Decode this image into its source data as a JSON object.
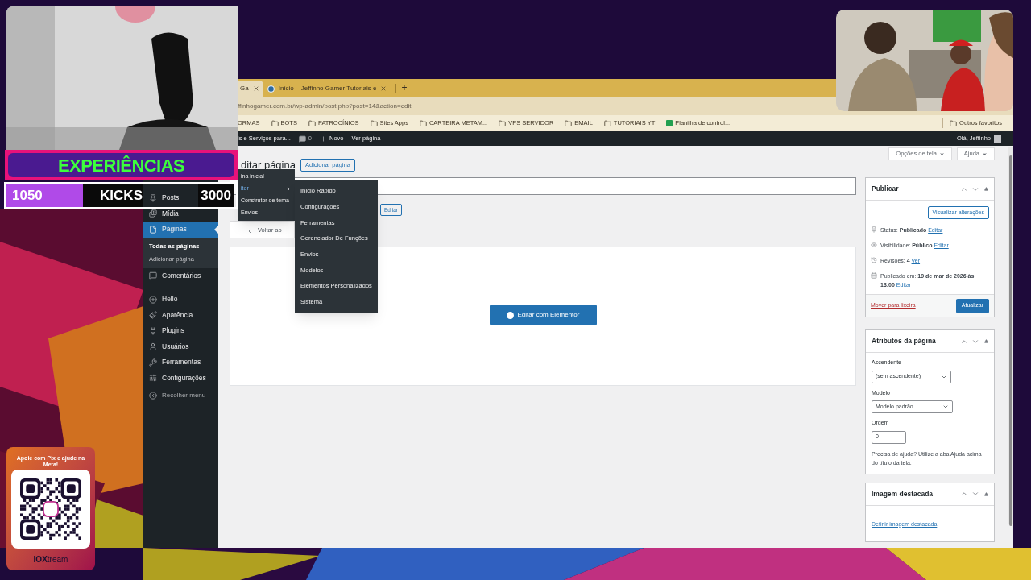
{
  "overlay": {
    "banner": "EXPERIÊNCIAS",
    "counter": {
      "current": "1050",
      "label": "KICKS",
      "goal": "3000"
    },
    "pix_card": {
      "title": "Apoie com Pix e ajude na Meta!",
      "brand": "**IOX**tream"
    }
  },
  "browser": {
    "tabs": [
      {
        "label": "Ga",
        "selected": true
      },
      {
        "label": "Início – Jeffinho Gamer Tutoriais e",
        "selected": false
      }
    ],
    "new_tab": "+",
    "address": "ffinhogamer.com.br/wp-admin/post.php?post=14&action=edit",
    "bookmarks": [
      {
        "label": "ORMAS",
        "kind": "text"
      },
      {
        "label": "BOTS",
        "kind": "folder"
      },
      {
        "label": "PATROCÍNIOS",
        "kind": "folder"
      },
      {
        "label": "Sites Apps",
        "kind": "folder"
      },
      {
        "label": "CARTEIRA METAM...",
        "kind": "folder"
      },
      {
        "label": "VPS SERVIDOR",
        "kind": "folder"
      },
      {
        "label": "EMAIL",
        "kind": "folder"
      },
      {
        "label": "TUTORIAIS YT",
        "kind": "folder"
      },
      {
        "label": "Planilha de control...",
        "kind": "sheet"
      }
    ],
    "other_bookmarks": "Outros favoritos"
  },
  "admin_bar": {
    "site": "is e Serviços para...",
    "comments": "0",
    "new": "Novo",
    "view": "Ver página",
    "greeting": "Olá, Jeffinho"
  },
  "sidebar": {
    "groups": [
      [
        {
          "label": "Posts",
          "selected": false
        },
        {
          "label": "Mídia",
          "selected": false
        },
        {
          "label": "Páginas",
          "selected": true,
          "children": [
            {
              "label": "Todas as páginas",
              "selected": true
            },
            {
              "label": "Adicionar página",
              "selected": false
            }
          ]
        },
        {
          "label": "Comentários",
          "selected": false
        }
      ],
      [
        {
          "label": "Hello",
          "selected": false
        },
        {
          "label": "Aparência",
          "selected": false
        },
        {
          "label": "Plugins",
          "selected": false
        },
        {
          "label": "Usuários",
          "selected": false
        },
        {
          "label": "Ferramentas",
          "selected": false
        },
        {
          "label": "Configurações",
          "selected": false
        }
      ]
    ],
    "collapse": "Recolher menu"
  },
  "flyout": {
    "items": [
      {
        "label": "ina inicial",
        "expanded": false
      },
      {
        "label": "itor",
        "expanded": true
      },
      {
        "label": "Construtor de tema",
        "expanded": false
      },
      {
        "label": "Envios",
        "expanded": false
      }
    ],
    "submenu": [
      "Início Rápido",
      "Configurações",
      "Ferramentas",
      "Gerenciador De Funções",
      "Envios",
      "Modelos",
      "Elementos Personalizados",
      "Sistema"
    ]
  },
  "screen_options": "Opções de tela",
  "help": "Ajuda",
  "editor": {
    "title": "ditar página",
    "add_new": "Adicionar página",
    "edit_button": "Editar",
    "back": "Voltar ao",
    "elementor_button": "Editar com Elementor"
  },
  "publish_box": {
    "title": "Publicar",
    "preview": "Visualizar alterações",
    "rows": [
      {
        "text": "Status: **Publicado**",
        "link": "Editar"
      },
      {
        "text": "Visibilidade: **Público**",
        "link": "Editar"
      },
      {
        "text": "Revisões: **4**",
        "link": "Ver"
      },
      {
        "text": "Publicado em: **19 de mar de 2026 às 13:00**",
        "link": "Editar"
      }
    ],
    "trash": "Mover para lixeira",
    "update": "Atualizar"
  },
  "attributes_box": {
    "title": "Atributos da página",
    "parent_label": "Ascendente",
    "parent_value": "(sem ascendente)",
    "template_label": "Modelo",
    "template_value": "Modelo padrão",
    "order_label": "Ordem",
    "order_value": "0",
    "help": "Precisa de ajuda? Utilize a aba Ajuda acima do título da tela."
  },
  "featured_box": {
    "title": "Imagem destacada",
    "link": "Definir imagem destacada"
  }
}
